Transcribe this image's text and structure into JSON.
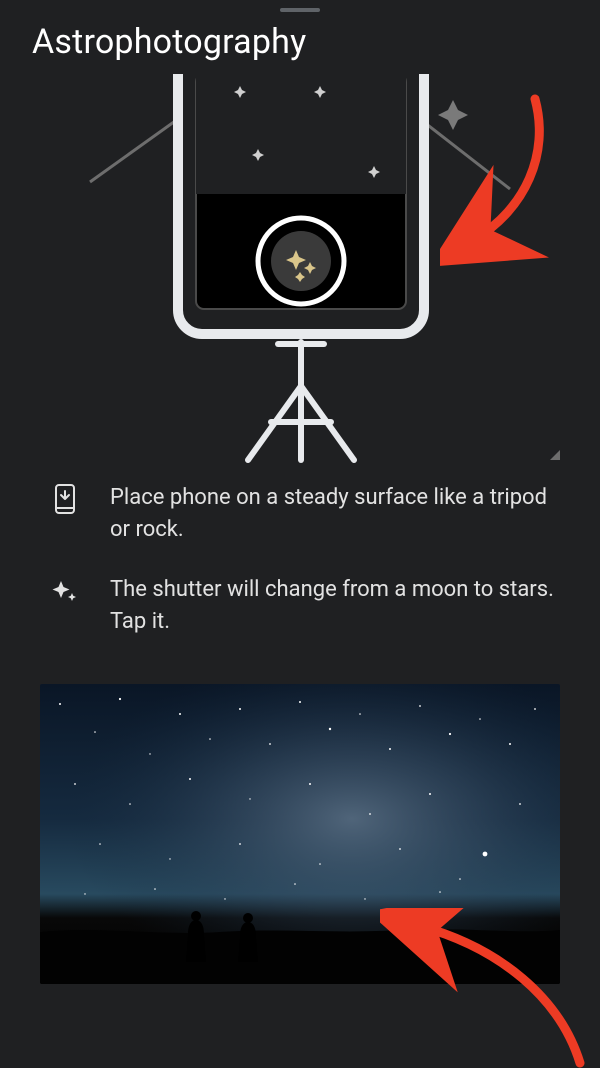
{
  "header": {
    "title": "Astrophotography"
  },
  "tips": [
    {
      "icon": "phone-down-icon",
      "text": "Place phone on a steady surface like a tripod or rock."
    },
    {
      "icon": "sparkle-icon",
      "text": "The shutter will change from a moon to stars. Tap it."
    }
  ],
  "annotations": {
    "arrow_color": "#ed3b24"
  }
}
